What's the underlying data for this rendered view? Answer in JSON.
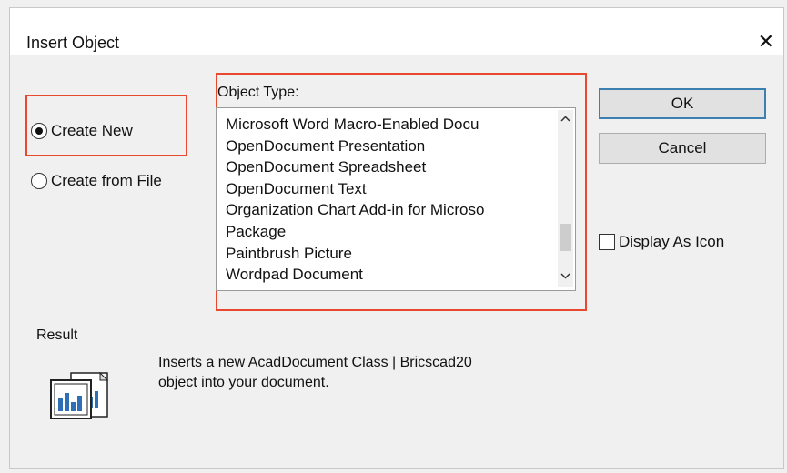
{
  "dialog": {
    "title": "Insert Object",
    "close_glyph": "✕"
  },
  "radios": [
    {
      "label": "Create New",
      "checked": true
    },
    {
      "label": "Create from File",
      "checked": false
    }
  ],
  "object_type": {
    "label": "Object Type:",
    "items": [
      "Microsoft Word Macro-Enabled Docu",
      "OpenDocument Presentation",
      "OpenDocument Spreadsheet",
      "OpenDocument Text",
      "Organization Chart Add-in for Microso",
      "Package",
      "Paintbrush Picture",
      "Wordpad Document"
    ],
    "scroll_position": 0.85
  },
  "buttons": {
    "ok": "OK",
    "cancel": "Cancel"
  },
  "display_as_icon": {
    "label": "Display As Icon",
    "checked": false
  },
  "result": {
    "label": "Result",
    "text_line1": "Inserts a new AcadDocument Class | Bricscad20",
    "text_line2": "object into your document."
  },
  "icons": {
    "scroll_up": "chevron-up-icon",
    "scroll_down": "chevron-down-icon",
    "result": "document-chart-icon"
  },
  "colors": {
    "highlight": "#e8482e",
    "default_button_border": "#3c7fb1"
  }
}
